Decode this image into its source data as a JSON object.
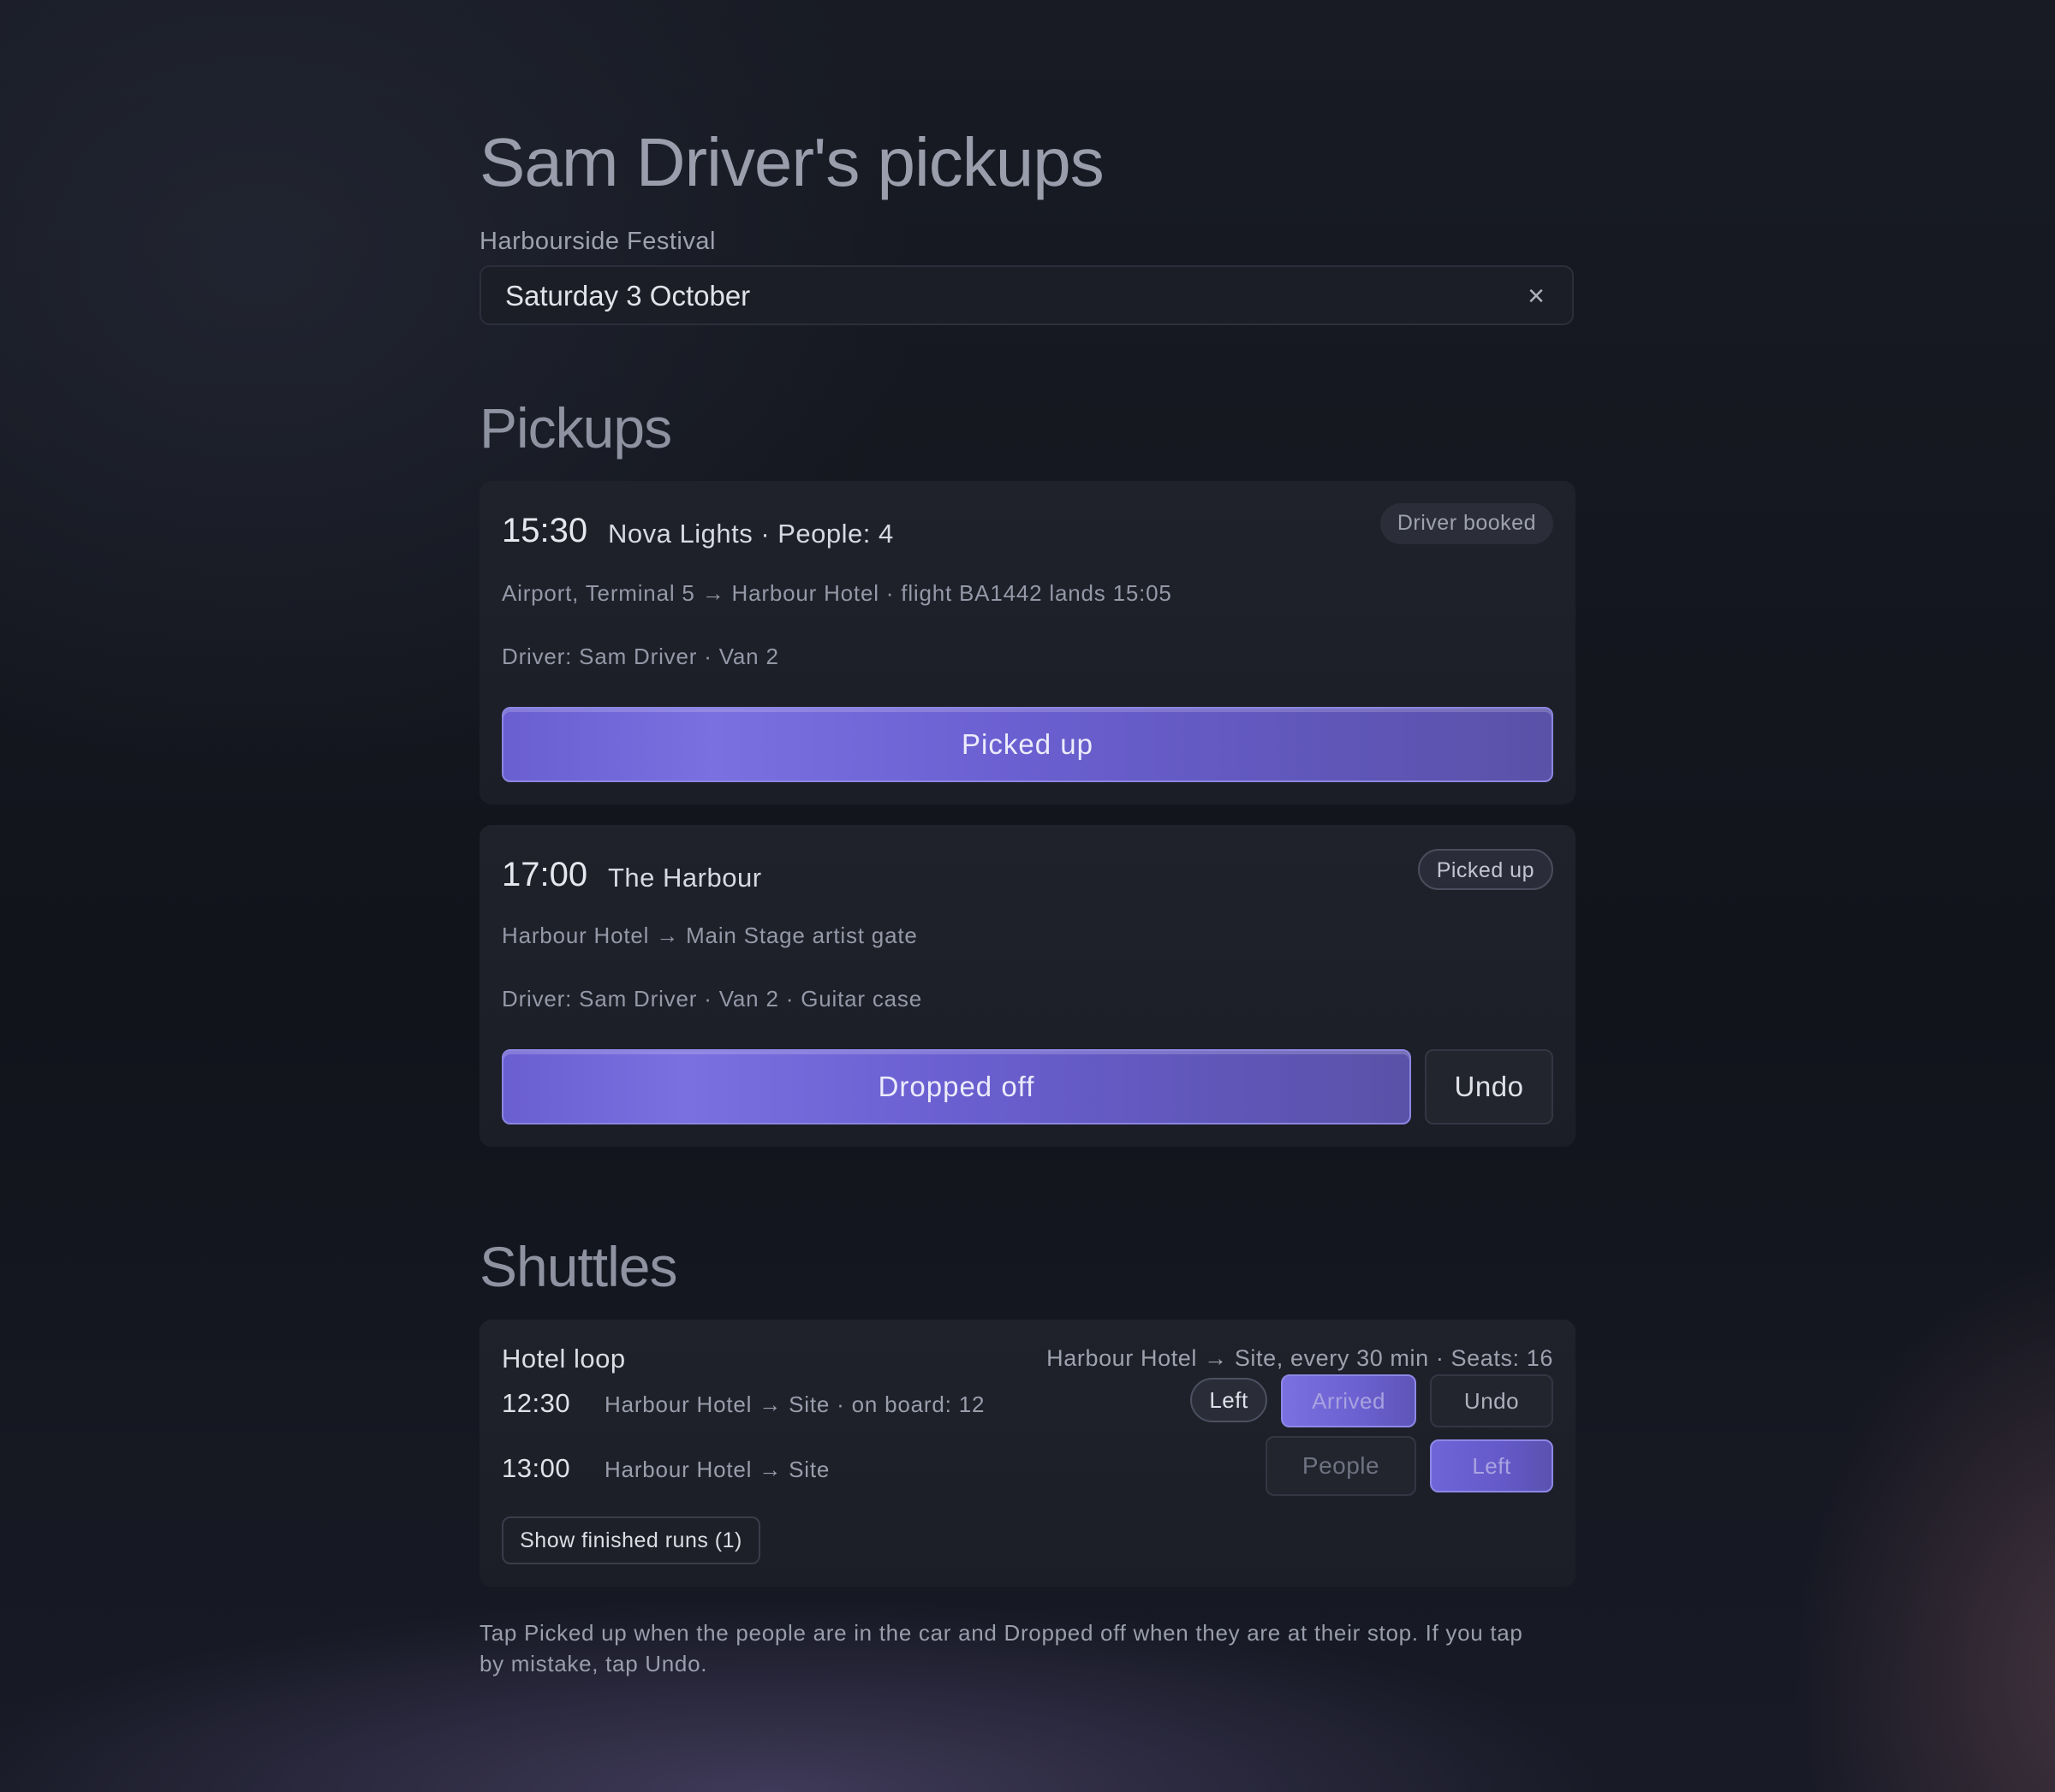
{
  "header": {
    "title": "Sam Driver's pickups",
    "event": "Harbourside Festival",
    "date": "Saturday 3 October",
    "clear_icon": "×"
  },
  "pickups": {
    "title": "Pickups",
    "items": [
      {
        "time": "15:30",
        "name": "Nova Lights · People: 4",
        "status": "Driver booked",
        "route": "Airport, Terminal 5 → Harbour Hotel · flight BA1442 lands 15:05",
        "driver": "Driver: Sam Driver · Van 2",
        "action": "Picked up"
      },
      {
        "time": "17:00",
        "name": "The Harbour",
        "status": "Picked up",
        "route": "Harbour Hotel → Main Stage artist gate",
        "driver": "Driver: Sam Driver · Van 2 · Guitar case",
        "action": "Dropped off",
        "undo": "Undo"
      }
    ]
  },
  "shuttles": {
    "title": "Shuttles",
    "loop": {
      "name": "Hotel loop",
      "info": "Harbour Hotel → Site, every 30 min · Seats: 16",
      "runs": [
        {
          "time": "12:30",
          "route": "Harbour Hotel → Site · on board: 12",
          "buttons": {
            "left": "Left",
            "arrived": "Arrived",
            "undo": "Undo"
          }
        },
        {
          "time": "13:00",
          "route": "Harbour Hotel → Site",
          "buttons": {
            "people": "People",
            "left": "Left"
          }
        }
      ],
      "finished_button": "Show finished runs (1)"
    }
  },
  "footnote": {
    "line1": "Tap Picked up when the people are in the car and Dropped off when they are at their stop. If you tap",
    "line2": "by mistake, tap Undo."
  },
  "colors": {
    "accent": "#6a5fd1",
    "accent_border": "#8b86e0",
    "background": "#12141c",
    "card": "#1f212b"
  }
}
